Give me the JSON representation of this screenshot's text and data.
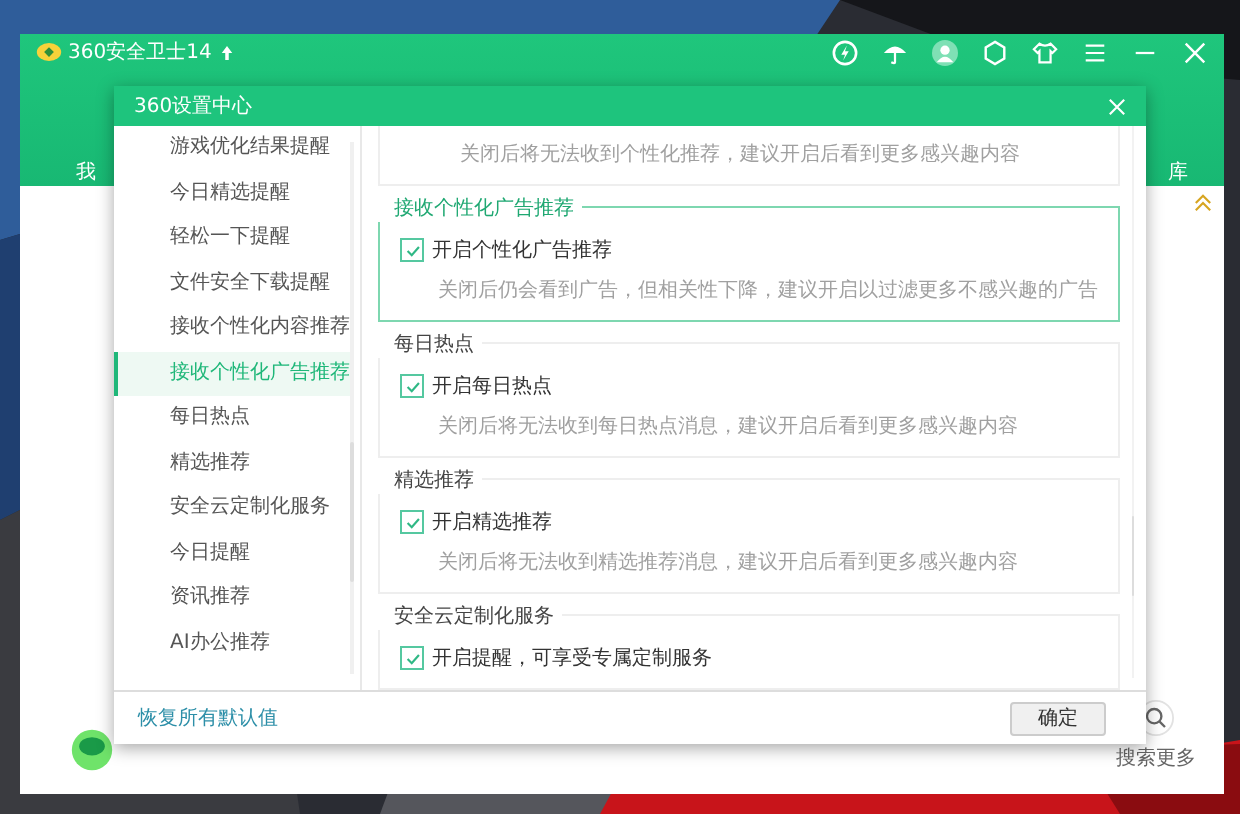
{
  "window": {
    "title": "360安全卫士14",
    "nav_left": "我",
    "nav_right": "库",
    "search_label": "搜索更多"
  },
  "dialog": {
    "title": "360设置中心",
    "sidebar": {
      "items": [
        {
          "label": "游戏优化结果提醒",
          "selected": false
        },
        {
          "label": "今日精选提醒",
          "selected": false
        },
        {
          "label": "轻松一下提醒",
          "selected": false
        },
        {
          "label": "文件安全下载提醒",
          "selected": false
        },
        {
          "label": "接收个性化内容推荐",
          "selected": false
        },
        {
          "label": "接收个性化广告推荐",
          "selected": true
        },
        {
          "label": "每日热点",
          "selected": false
        },
        {
          "label": "精选推荐",
          "selected": false
        },
        {
          "label": "安全云定制化服务",
          "selected": false
        },
        {
          "label": "今日提醒",
          "selected": false
        },
        {
          "label": "资讯推荐",
          "selected": false
        },
        {
          "label": "AI办公推荐",
          "selected": false
        }
      ]
    },
    "sections": [
      {
        "description": "关闭后将无法收到个性化推荐，建议开启后看到更多感兴趣内容",
        "selected": false
      },
      {
        "title": "接收个性化广告推荐",
        "checkbox": {
          "label": "开启个性化广告推荐",
          "checked": true
        },
        "description": "关闭后仍会看到广告，但相关性下降，建议开启以过滤更多不感兴趣的广告",
        "selected": true
      },
      {
        "title": "每日热点",
        "checkbox": {
          "label": "开启每日热点",
          "checked": true
        },
        "description": "关闭后将无法收到每日热点消息，建议开启后看到更多感兴趣内容",
        "selected": false
      },
      {
        "title": "精选推荐",
        "checkbox": {
          "label": "开启精选推荐",
          "checked": true
        },
        "description": "关闭后将无法收到精选推荐消息，建议开启后看到更多感兴趣内容",
        "selected": false
      },
      {
        "title": "安全云定制化服务",
        "checkbox": {
          "label": "开启提醒，可享受专属定制服务",
          "checked": true
        },
        "selected": false
      }
    ],
    "restore_link": "恢复所有默认值",
    "ok_button": "确定"
  }
}
